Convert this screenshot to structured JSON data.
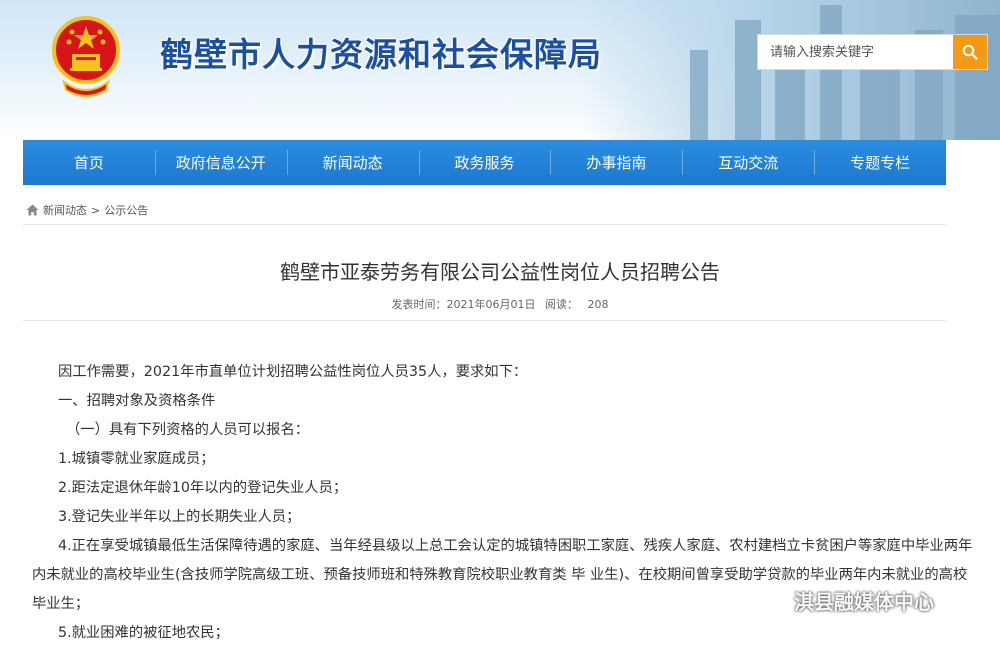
{
  "header": {
    "site_title": "鹤壁市人力资源和社会保障局",
    "search_placeholder": "请输入搜索关键字"
  },
  "nav": {
    "items": [
      "首页",
      "政府信息公开",
      "新闻动态",
      "政务服务",
      "办事指南",
      "互动交流",
      "专题专栏"
    ]
  },
  "breadcrumb": {
    "items": [
      "新闻动态",
      "公示公告"
    ],
    "separator": ">"
  },
  "article": {
    "title": "鹤壁市亚泰劳务有限公司公益性岗位人员招聘公告",
    "publish_label": "发表时间：2021年06月01日",
    "views_label": "阅读：",
    "views_count": "208",
    "paragraphs": [
      "因工作需要，2021年市直单位计划招聘公益性岗位人员35人，要求如下：",
      "一、招聘对象及资格条件",
      "（一）具有下列资格的人员可以报名：",
      "1.城镇零就业家庭成员；",
      "2.距法定退休年龄10年以内的登记失业人员；",
      "3.登记失业半年以上的长期失业人员；",
      "4.正在享受城镇最低生活保障待遇的家庭、当年经县级以上总工会认定的城镇特困职工家庭、残疾人家庭、农村建档立卡贫困户等家庭中毕业两年内未就业的高校毕业生(含技师学院高级工班、预备技师班和特殊教育院校职业教育类 毕 业生)、在校期间曾享受助学贷款的毕业两年内未就业的高校毕业生；",
      "5.就业困难的被征地农民；"
    ]
  },
  "watermark": {
    "text": "淇县融媒体中心"
  },
  "colors": {
    "nav_blue": "#1f80d6",
    "title_blue": "#1a4fa6",
    "search_orange": "#f39a15",
    "emblem_red": "#d7141a",
    "emblem_gold": "#f7c21c"
  }
}
